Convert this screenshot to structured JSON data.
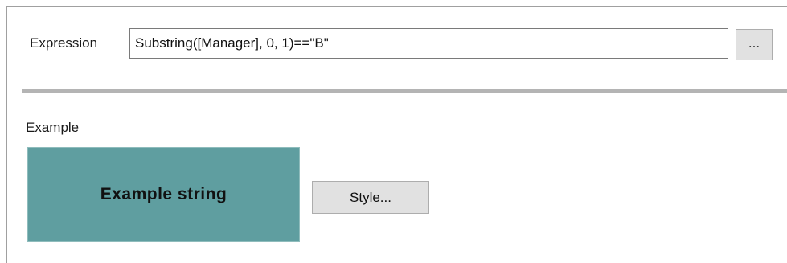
{
  "expression": {
    "label": "Expression",
    "value": "Substring([Manager], 0, 1)==\"B\"",
    "browse_button_label": "..."
  },
  "example": {
    "label": "Example",
    "preview_text": "Example string",
    "preview_background": "#5f9ea0",
    "style_button_label": "Style..."
  }
}
